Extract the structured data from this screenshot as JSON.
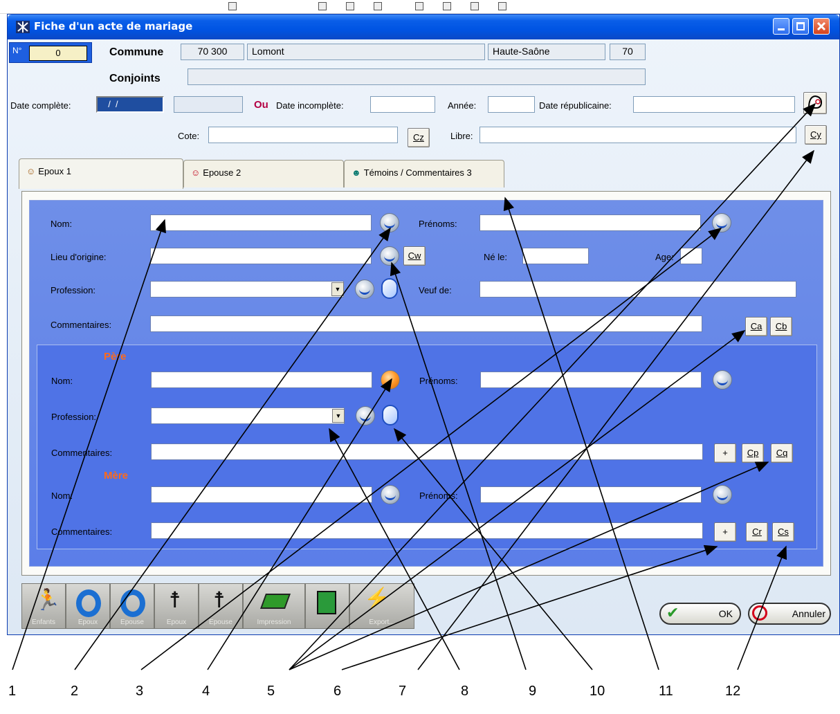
{
  "window": {
    "title": "Fiche d'un acte de mariage"
  },
  "header": {
    "number_label": "N°",
    "number_value": "0",
    "commune_label": "Commune",
    "postal_code": "70 300",
    "commune_name": "Lomont",
    "departement": "Haute-Saône",
    "departement_num": "70",
    "conjoints_label": "Conjoints",
    "conjoints_value": ""
  },
  "dates": {
    "date_complete_label": "Date complète:",
    "date_complete_value": "  /  /",
    "ou_label": "Ou",
    "date_incomplete_label": "Date incomplète:",
    "annee_label": "Année:",
    "date_republicaine_label": "Date républicaine:",
    "cote_label": "Cote:",
    "cz_button": "Cz",
    "libre_label": "Libre:",
    "cy_button": "Cy"
  },
  "tabs": [
    {
      "label": "Epoux 1"
    },
    {
      "label": "Epouse 2"
    },
    {
      "label": "Témoins / Commentaires 3"
    }
  ],
  "epoux": {
    "nom_label": "Nom:",
    "prenoms_label": "Prénoms:",
    "lieu_label": "Lieu d'origine:",
    "cw_button": "Cw",
    "ne_le_label": "Né le:",
    "age_label": "Age:",
    "profession_label": "Profession:",
    "veuf_label": "Veuf de:",
    "commentaires_label": "Commentaires:",
    "ca_button": "Ca",
    "cb_button": "Cb"
  },
  "pere": {
    "section_label": "Père",
    "nom_label": "Nom:",
    "prenoms_label": "Prénoms:",
    "profession_label": "Profession:",
    "commentaires_label": "Commentaires:",
    "plus_button": "+",
    "cp_button": "Cp",
    "cq_button": "Cq"
  },
  "mere": {
    "section_label": "Mère",
    "nom_label": "Nom:",
    "prenoms_label": "Prénoms:",
    "commentaires_label": "Commentaires:",
    "plus_button": "+",
    "cr_button": "Cr",
    "cs_button": "Cs"
  },
  "toolbar": {
    "tools": [
      "Enfants",
      "Epoux",
      "Epouse",
      "Epoux",
      "Epouse",
      "Impression",
      "",
      "Export..."
    ]
  },
  "actions": {
    "ok_label": "OK",
    "cancel_label": "Annuler"
  },
  "callouts": [
    "1",
    "2",
    "3",
    "4",
    "5",
    "6",
    "7",
    "8",
    "9",
    "10",
    "11",
    "12"
  ]
}
